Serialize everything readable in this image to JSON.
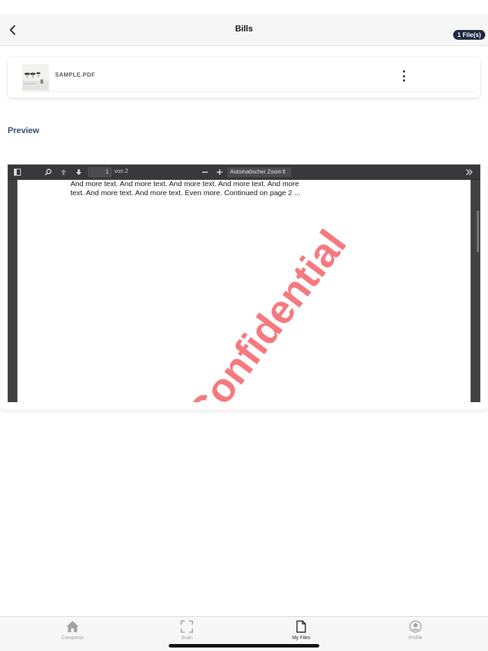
{
  "header": {
    "title": "Bills",
    "badge": "1 File(s)"
  },
  "file": {
    "name": "SAMPLE.PDF"
  },
  "preview": {
    "heading": "Preview"
  },
  "viewer": {
    "page_number": "1",
    "page_of": "von 2",
    "zoom_label": "Automatischer Zoom",
    "pdf_text": "And more text. And more text. And more text. And more text. And more text. And more text. And more text. Even more. Continued on page 2 ...",
    "watermark": "Confidential",
    "watermark_color": "#f47a7f"
  },
  "tabbar": {
    "tabs": [
      {
        "label": "Compress",
        "icon": "home-icon"
      },
      {
        "label": "Scan",
        "icon": "scan-icon"
      },
      {
        "label": "My Files",
        "icon": "file-icon"
      },
      {
        "label": "Profile",
        "icon": "profile-icon"
      }
    ],
    "active": "My Files"
  },
  "colors": {
    "accent": "#34476b",
    "badge_bg": "#1d2740"
  }
}
